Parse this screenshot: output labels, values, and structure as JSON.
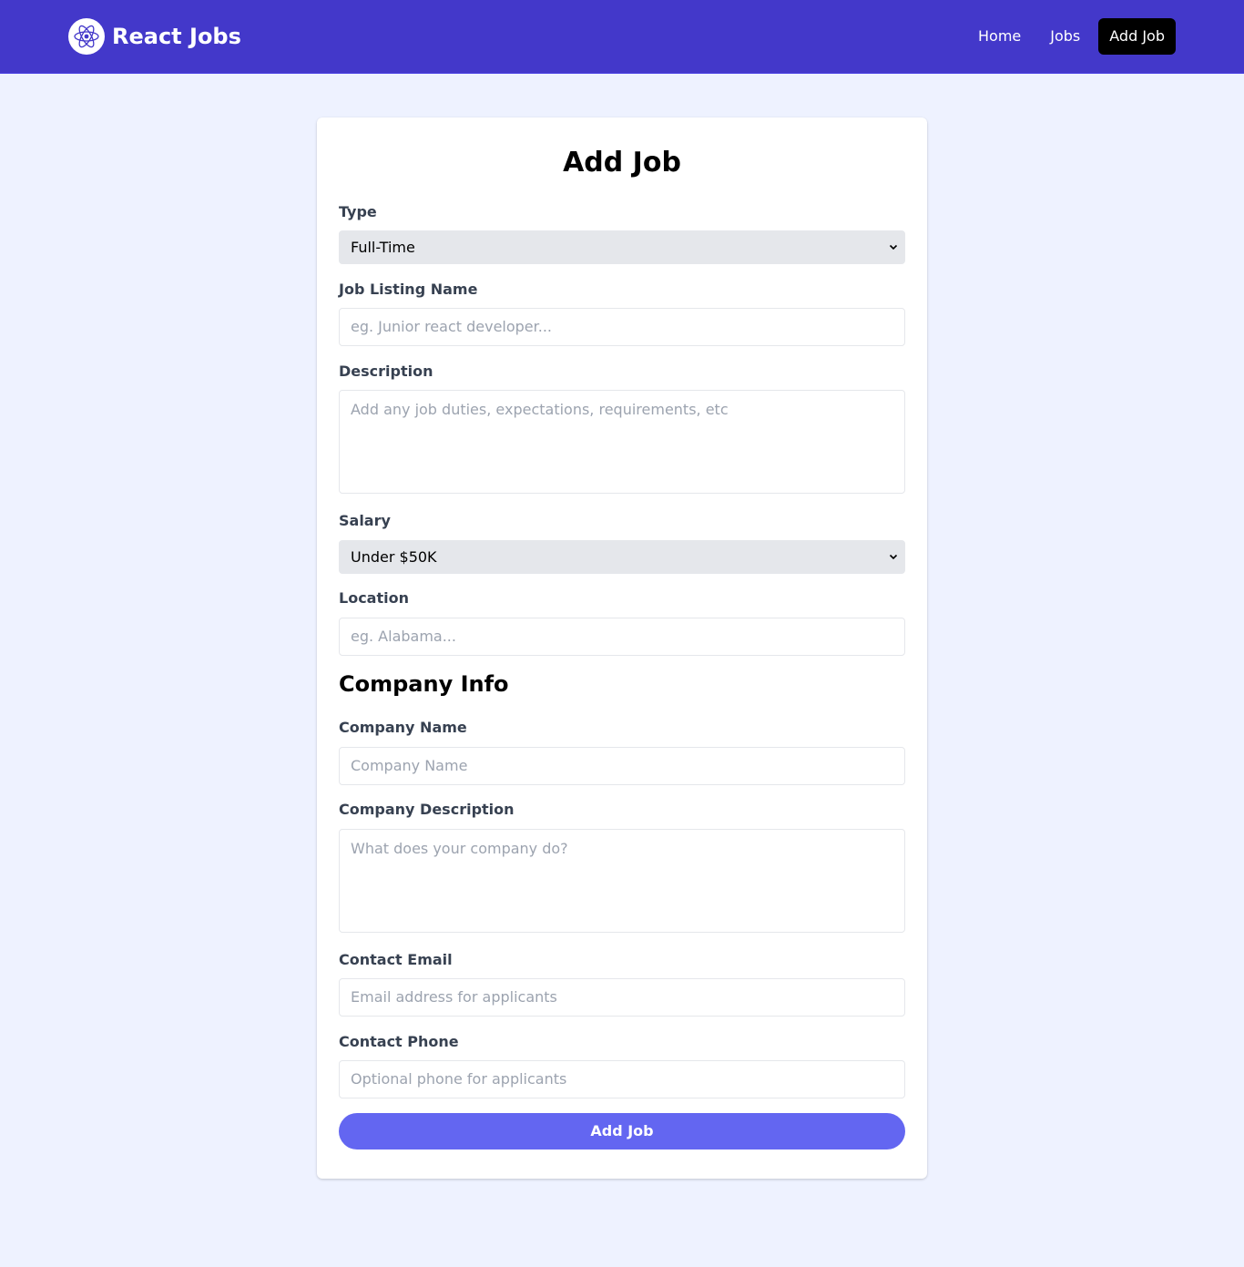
{
  "navbar": {
    "brand": "React Jobs",
    "links": [
      {
        "label": "Home"
      },
      {
        "label": "Jobs"
      },
      {
        "label": "Add Job",
        "active": true
      }
    ]
  },
  "form": {
    "title": "Add Job",
    "type": {
      "label": "Type",
      "value": "Full-Time"
    },
    "job_listing_name": {
      "label": "Job Listing Name",
      "placeholder": "eg. Junior react developer..."
    },
    "description": {
      "label": "Description",
      "placeholder": "Add any job duties, expectations, requirements, etc"
    },
    "salary": {
      "label": "Salary",
      "value": "Under $50K"
    },
    "location": {
      "label": "Location",
      "placeholder": "eg. Alabama..."
    },
    "company_section_title": "Company Info",
    "company_name": {
      "label": "Company Name",
      "placeholder": "Company Name"
    },
    "company_description": {
      "label": "Company Description",
      "placeholder": "What does your company do?"
    },
    "contact_email": {
      "label": "Contact Email",
      "placeholder": "Email address for applicants"
    },
    "contact_phone": {
      "label": "Contact Phone",
      "placeholder": "Optional phone for applicants"
    },
    "submit_label": "Add Job"
  },
  "colors": {
    "navbar_bg": "#4338ca",
    "page_bg": "#eef2ff",
    "submit_bg": "#6366f1",
    "active_nav_bg": "#000000"
  },
  "icons": {
    "logo": "react-atom-icon",
    "select_arrow": "chevron-down-icon"
  }
}
